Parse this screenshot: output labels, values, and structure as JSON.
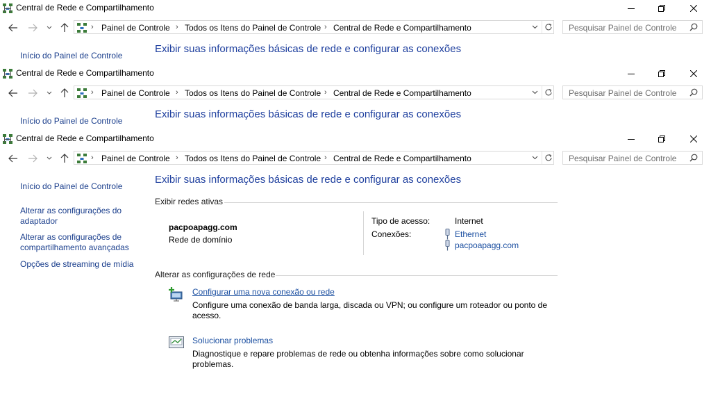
{
  "window": {
    "title": "Central de Rede e Compartilhamento",
    "minimize_icon": "minimize-icon",
    "restore_icon": "restore-icon",
    "close_icon": "close-icon"
  },
  "nav": {
    "back_icon": "back-arrow-icon",
    "forward_icon": "forward-arrow-icon",
    "recent_icon": "chevron-down-icon",
    "up_icon": "up-arrow-icon"
  },
  "breadcrumb": [
    "Painel de Controle",
    "Todos os Itens do Painel de Controle",
    "Central de Rede e Compartilhamento"
  ],
  "search": {
    "placeholder": "Pesquisar Painel de Controle"
  },
  "sidebar": {
    "home": "Início do Painel de Controle",
    "items": [
      "Alterar as configurações do adaptador",
      "Alterar as configurações de compartilhamento avançadas",
      "Opções de streaming de mídia"
    ]
  },
  "main": {
    "title": "Exibir suas informações básicas de rede e configurar as conexões",
    "active_networks_heading": "Exibir redes ativas",
    "network_name": "pacpoapagg.com",
    "network_type": "Rede de domínio",
    "access_type_label": "Tipo de acesso:",
    "access_type_value": "Internet",
    "connections_label": "Conexões:",
    "connections": [
      "Ethernet",
      "pacpoapagg.com"
    ],
    "change_settings_heading": "Alterar as configurações de rede",
    "tasks": [
      {
        "title": "Configurar uma nova conexão ou rede",
        "description": "Configure uma conexão de banda larga, discada ou VPN; ou configure um roteador ou ponto de acesso.",
        "icon": "new-connection-icon"
      },
      {
        "title": "Solucionar problemas",
        "description": "Diagnostique e repare problemas de rede ou obtenha informações sobre como solucionar problemas.",
        "icon": "troubleshoot-icon"
      }
    ]
  },
  "colors": {
    "link": "#1a3e8c",
    "title": "#1e3f9e"
  }
}
